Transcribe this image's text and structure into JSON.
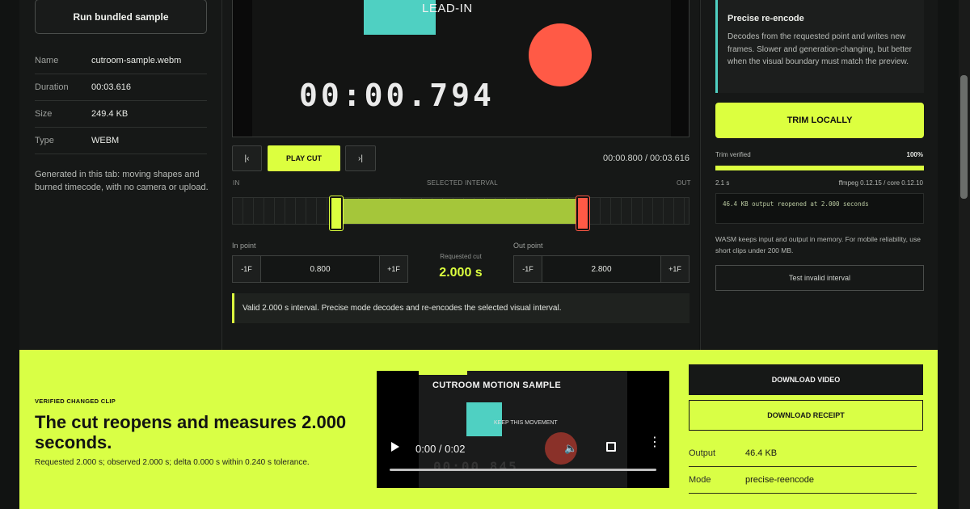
{
  "source": {
    "run_sample_label": "Run bundled sample",
    "meta": [
      {
        "key": "Name",
        "value": "cutroom-sample.webm"
      },
      {
        "key": "Duration",
        "value": "00:03.616"
      },
      {
        "key": "Size",
        "value": "249.4 KB"
      },
      {
        "key": "Type",
        "value": "WEBM"
      }
    ],
    "note": "Generated in this tab: moving shapes and burned timecode, with no camera or upload."
  },
  "preview": {
    "lead_in": "LEAD-IN",
    "timecode": "00:00.794"
  },
  "transport": {
    "prev_label": "|‹",
    "play_cut_label": "PLAY CUT",
    "next_label": "›|",
    "position": "00:00.800 / 00:03.616"
  },
  "timeline": {
    "in_label": "IN",
    "selected_label": "SELECTED INTERVAL",
    "out_label": "OUT",
    "selection_start_fraction": 0.221,
    "selection_end_fraction": 0.774
  },
  "inpoint": {
    "label": "In point",
    "minus": "-1F",
    "value": "0.800",
    "plus": "+1F"
  },
  "requested": {
    "label": "Requested cut",
    "value": "2.000 s"
  },
  "outpoint": {
    "label": "Out point",
    "minus": "-1F",
    "value": "2.800",
    "plus": "+1F"
  },
  "validation": "Valid 2.000 s interval. Precise mode decodes and re-encodes the selected visual interval.",
  "mode_card": {
    "title": "Precise re-encode",
    "body": "Decodes from the requested point and writes new frames. Slower and generation-changing, but better when the visual boundary must match the preview."
  },
  "trim": {
    "button": "TRIM LOCALLY",
    "verified_label": "Trim verified",
    "percent": "100%",
    "progress": 1.0,
    "elapsed": "2.1 s",
    "versions": "ffmpeg 0.12.15 / core 0.12.10",
    "log": "46.4 KB output reopened at 2.000 seconds",
    "wasm_note": "WASM keeps input and output in memory. For mobile reliability, use short clips under 200 MB.",
    "test_button": "Test invalid interval"
  },
  "result": {
    "eyebrow": "VERIFIED CHANGED CLIP",
    "headline": "The cut reopens and measures 2.000 seconds.",
    "sub": "Requested 2.000 s; observed 2.000 s; delta 0.000 s within 0.240 s tolerance.",
    "video": {
      "title": "CUTROOM MOTION SAMPLE",
      "keep": "KEEP THIS MOVEMENT",
      "timecode": "00:00.845",
      "time": "0:00 / 0:02"
    },
    "download_video": "DOWNLOAD VIDEO",
    "download_receipt": "DOWNLOAD RECEIPT",
    "outputs": [
      {
        "key": "Output",
        "value": "46.4 KB"
      },
      {
        "key": "Mode",
        "value": "precise-reencode"
      }
    ]
  },
  "colors": {
    "accent": "#dcff3f",
    "teal": "#4fd0c2",
    "red": "#ff5a46",
    "panel": "#161817"
  }
}
